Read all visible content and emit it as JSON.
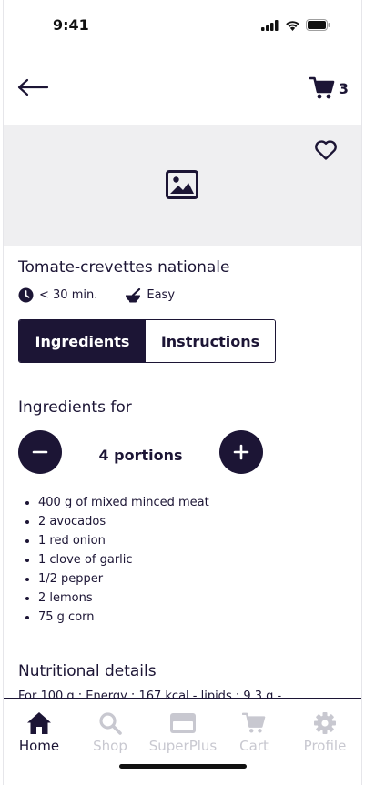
{
  "status_bar": {
    "time": "9:41"
  },
  "header": {
    "cart_count": "3"
  },
  "recipe": {
    "title": "Tomate-crevettes nationale",
    "time": "< 30 min.",
    "difficulty": "Easy"
  },
  "tabs": [
    {
      "label": "Ingredients",
      "active": true
    },
    {
      "label": "Instructions",
      "active": false
    }
  ],
  "ingredients": {
    "heading": "Ingredients for",
    "portions": "4 portions",
    "items": [
      "400 g of mixed minced meat",
      "2 avocados",
      "1 red onion",
      "1 clove of garlic",
      "1/2 pepper",
      "2 lemons",
      "75 g corn"
    ]
  },
  "nutrition": {
    "heading": "Nutritional details",
    "text": "For 100 g : Energy : 167 kcal - lipids : 9.3 g -"
  },
  "nav": [
    {
      "label": "Home",
      "icon": "home-icon",
      "active": true
    },
    {
      "label": "Shop",
      "icon": "search-icon",
      "active": false
    },
    {
      "label": "SuperPlus",
      "icon": "card-icon",
      "active": false
    },
    {
      "label": "Cart",
      "icon": "cart-icon",
      "active": false
    },
    {
      "label": "Profile",
      "icon": "gear-icon",
      "active": false
    }
  ],
  "colors": {
    "primary": "#1c1535",
    "inactive": "#c8c8d0",
    "hero_bg": "#efeff1"
  }
}
